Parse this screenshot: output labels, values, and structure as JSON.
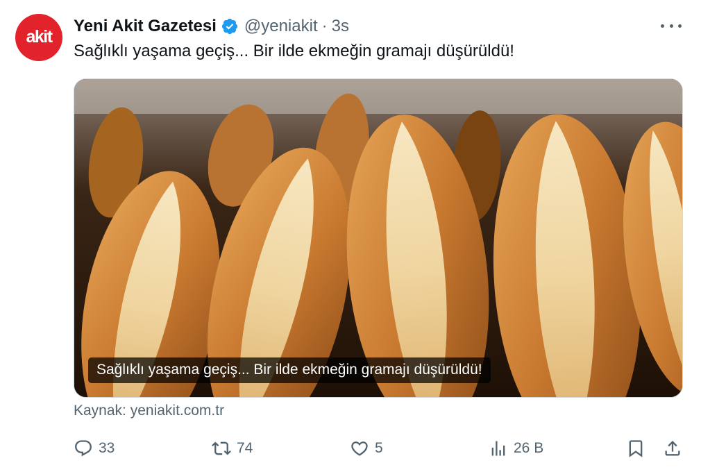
{
  "tweet": {
    "avatar_text": "akit",
    "display_name": "Yeni Akit Gazetesi",
    "handle": "@yeniakit",
    "separator": "·",
    "time": "3s",
    "text": "Sağlıklı yaşama geçiş... Bir ilde ekmeğin gramajı düşürüldü!",
    "media_caption": "Sağlıklı yaşama geçiş... Bir ilde ekmeğin gramajı düşürüldü!",
    "source": "Kaynak: yeniakit.com.tr"
  },
  "actions": {
    "reply_count": "33",
    "retweet_count": "74",
    "like_count": "5",
    "views_count": "26 B"
  },
  "icons": {
    "verified": "verified-badge-icon",
    "more": "more-options-icon",
    "reply": "reply-icon",
    "retweet": "retweet-icon",
    "like": "heart-icon",
    "views": "views-icon",
    "bookmark": "bookmark-icon",
    "share": "share-icon"
  },
  "colors": {
    "avatar_bg": "#e3232c",
    "verified": "#1d9bf0",
    "secondary_text": "#536471",
    "primary_text": "#0f1419"
  }
}
